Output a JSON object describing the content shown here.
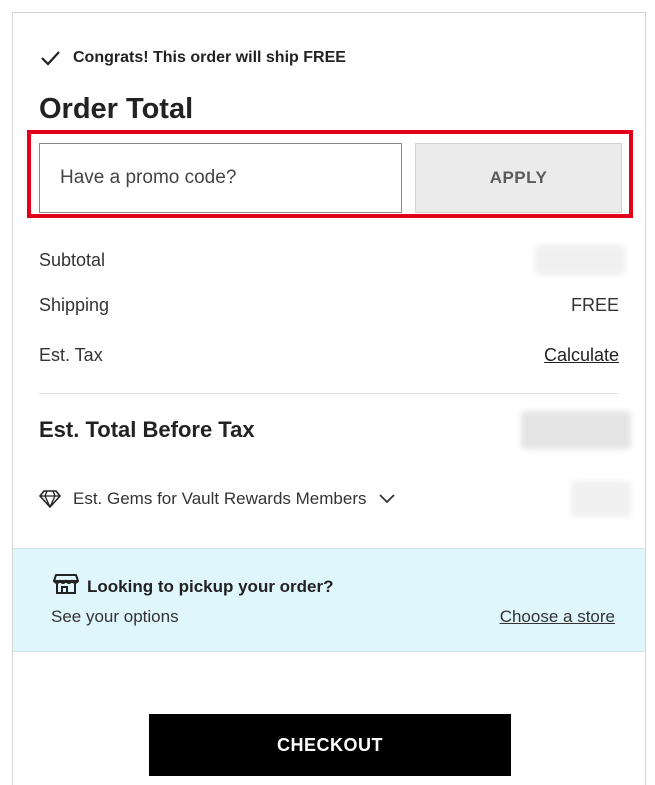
{
  "shipping_notice": {
    "text": "Congrats! This order will ship FREE",
    "icon": "check-icon"
  },
  "order_total": {
    "title": "Order Total",
    "promo": {
      "placeholder": "Have a promo code?",
      "value": "",
      "apply_label": "APPLY",
      "highlight_color": "#e2001a"
    },
    "lines": {
      "subtotal": {
        "label": "Subtotal"
      },
      "shipping": {
        "label": "Shipping",
        "value": "FREE"
      },
      "tax": {
        "label": "Est. Tax",
        "link": "Calculate"
      }
    },
    "total": {
      "label": "Est. Total Before Tax"
    },
    "gems": {
      "label": "Est. Gems for Vault Rewards Members",
      "icon": "diamond-icon",
      "toggle_icon": "chevron-down-icon"
    }
  },
  "pickup": {
    "icon": "store-icon",
    "title": "Looking to pickup your order?",
    "subtitle": "See your options",
    "link": "Choose a store",
    "background": "#dff6fd"
  },
  "checkout": {
    "label": "CHECKOUT",
    "color": "#000000"
  }
}
